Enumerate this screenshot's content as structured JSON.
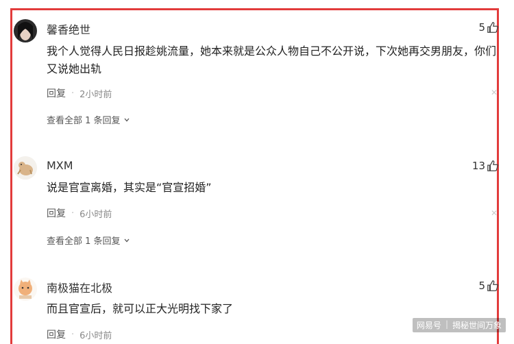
{
  "comments": [
    {
      "username": "馨香绝世",
      "likes": "5",
      "text": "我个人觉得人民日报趁姚流量，她本来就是公众人物自己不公开说，下次她再交男朋友，你们又说她出轨",
      "reply_label": "回复",
      "time": "2小时前",
      "view_all": "查看全部 1 条回复"
    },
    {
      "username": "MXM",
      "likes": "13",
      "text": "说是官宣离婚，其实是“官宣招婚”",
      "reply_label": "回复",
      "time": "6小时前",
      "view_all": "查看全部 1 条回复"
    },
    {
      "username": "南极猫在北极",
      "likes": "5",
      "text": "而且官宣后，就可以正大光明找下家了",
      "reply_label": "回复",
      "time": "6小时前"
    }
  ],
  "watermark": {
    "site": "网易号",
    "author": "揭秘世间万象"
  },
  "icons": {
    "like": "thumbs-up-icon",
    "close": "close-icon",
    "expand": "chevron-down-icon"
  },
  "colors": {
    "frame": "#e23b3b"
  }
}
